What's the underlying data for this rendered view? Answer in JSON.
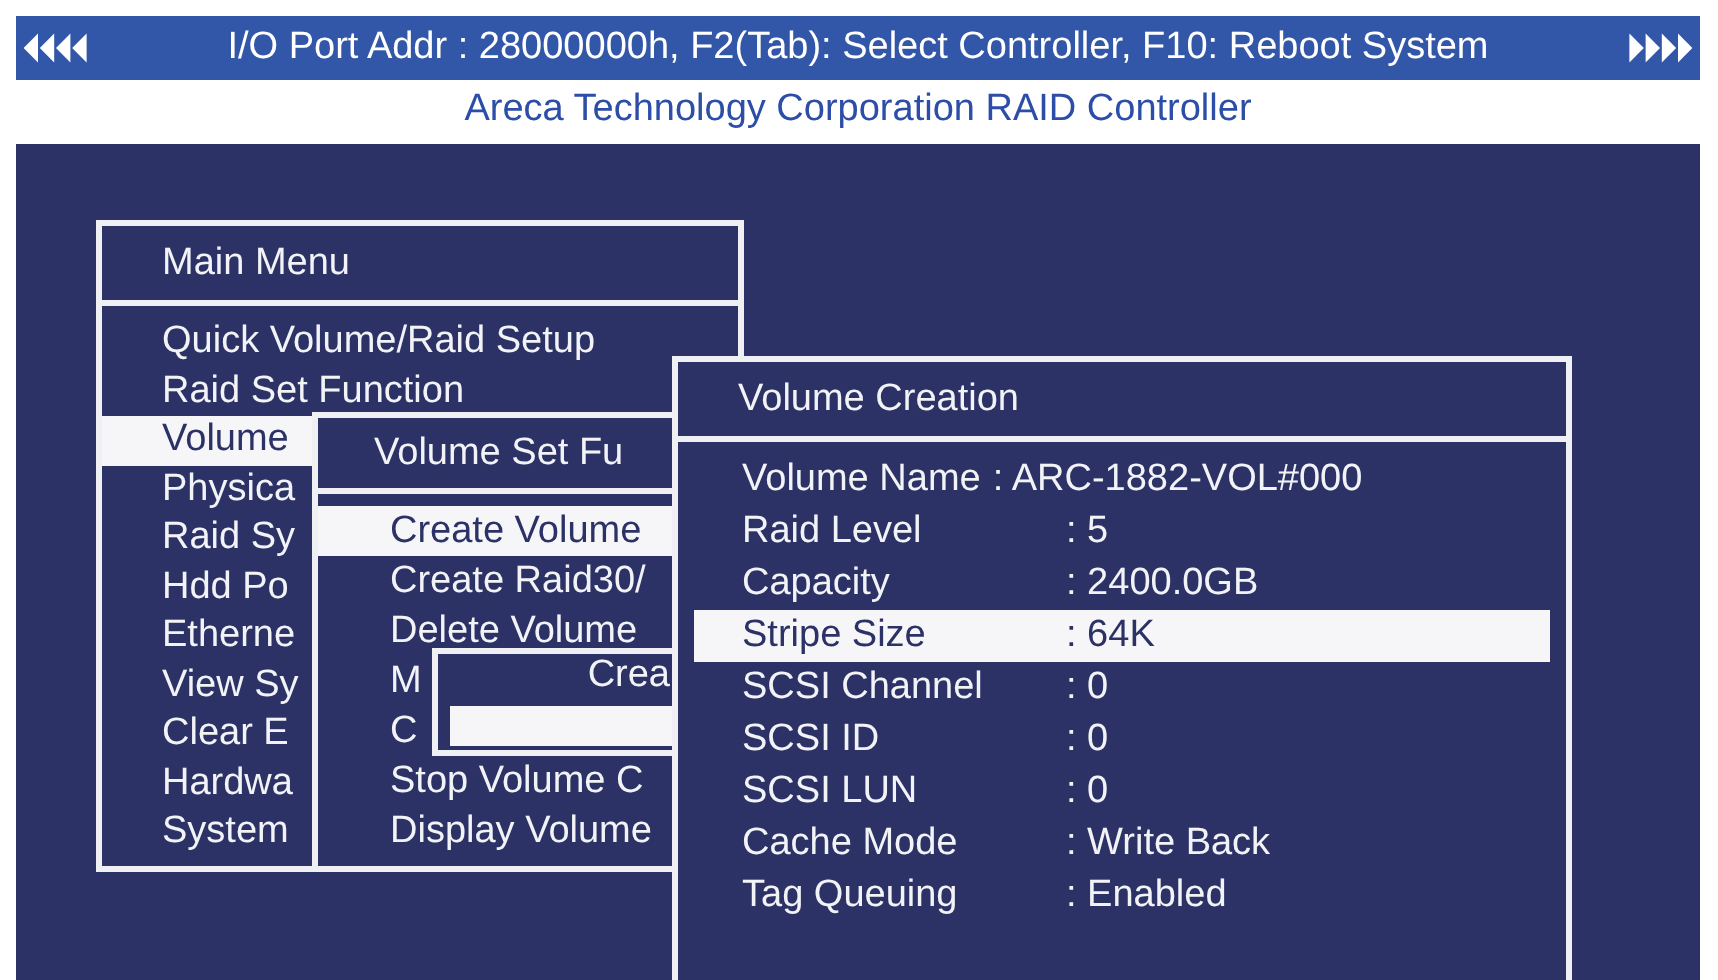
{
  "title_bar": {
    "text": "I/O Port Addr : 28000000h, F2(Tab): Select Controller, F10: Reboot System"
  },
  "subtitle": "Areca Technology Corporation RAID Controller",
  "main_menu": {
    "title": "Main Menu",
    "items": [
      {
        "label": "Quick Volume/Raid Setup",
        "selected": false
      },
      {
        "label": "Raid Set Function",
        "selected": false
      },
      {
        "label": "Volume",
        "selected": true
      },
      {
        "label": "Physica",
        "selected": false
      },
      {
        "label": "Raid Sy",
        "selected": false
      },
      {
        "label": "Hdd Po",
        "selected": false
      },
      {
        "label": "Etherne",
        "selected": false
      },
      {
        "label": "View Sy",
        "selected": false
      },
      {
        "label": "Clear E",
        "selected": false
      },
      {
        "label": "Hardwa",
        "selected": false
      },
      {
        "label": "System",
        "selected": false
      }
    ]
  },
  "submenu": {
    "title": "Volume Set Fu",
    "items": [
      {
        "label": "Create Volume",
        "selected": true
      },
      {
        "label": "Create Raid30/",
        "selected": false
      },
      {
        "label": "Delete Volume",
        "selected": false
      },
      {
        "label": "M",
        "selected": false
      },
      {
        "label": "C",
        "selected": false
      },
      {
        "label": "Stop Volume C",
        "selected": false
      },
      {
        "label": "Display Volume",
        "selected": false
      }
    ]
  },
  "dialog": {
    "title": "Crea"
  },
  "volume_creation": {
    "title": "Volume Creation",
    "fields": [
      {
        "kind": "inline",
        "label": "Volume Name",
        "value": ": ARC-1882-VOL#000",
        "selected": false
      },
      {
        "kind": "column",
        "label": "Raid Level",
        "value": ":  5",
        "selected": false
      },
      {
        "kind": "column",
        "label": "Capacity",
        "value": ":  2400.0GB",
        "selected": false
      },
      {
        "kind": "column",
        "label": "Stripe Size",
        "value": ":  64K",
        "selected": true
      },
      {
        "kind": "column",
        "label": "SCSI  Channel",
        "value": ":  0",
        "selected": false
      },
      {
        "kind": "column",
        "label": "SCSI  ID",
        "value": ":  0",
        "selected": false
      },
      {
        "kind": "column",
        "label": "SCSI  LUN",
        "value": ":  0",
        "selected": false
      },
      {
        "kind": "column",
        "label": "Cache Mode",
        "value": ":  Write Back",
        "selected": false
      },
      {
        "kind": "column",
        "label": "Tag Queuing",
        "value": ":  Enabled",
        "selected": false
      }
    ]
  }
}
